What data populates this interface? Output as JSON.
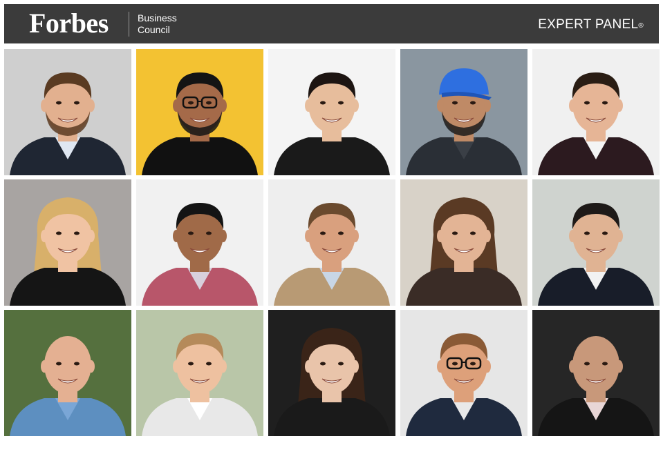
{
  "header": {
    "logo": "Forbes",
    "council_line1": "Business",
    "council_line2": "Council",
    "expert_panel": "EXPERT PANEL",
    "registered_mark": "®"
  },
  "colors": {
    "banner": "#3b3b3b",
    "text": "#ffffff"
  },
  "portraits": [
    {
      "bg": "#cfcfcf",
      "skin": "#e2b08f",
      "hair": "#5a3b22",
      "jacket": "#1f2633",
      "shirt": "#dfe7f2",
      "hairstyle": "short",
      "beard": true,
      "glasses": false,
      "cap": false
    },
    {
      "bg": "#f3c232",
      "skin": "#a56a49",
      "hair": "#141414",
      "jacket": "#111111",
      "shirt": "#111111",
      "hairstyle": "short",
      "beard": true,
      "glasses": true,
      "cap": false
    },
    {
      "bg": "#f4f4f4",
      "skin": "#e7bd9c",
      "hair": "#1d1512",
      "jacket": "#1a1a1a",
      "shirt": "#1a1a1a",
      "hairstyle": "pulled",
      "beard": false,
      "glasses": false,
      "cap": false
    },
    {
      "bg": "#8a96a0",
      "skin": "#bf8a66",
      "hair": "#1b1b1b",
      "jacket": "#2a2f36",
      "shirt": "#3a3f46",
      "hairstyle": "none",
      "beard": true,
      "glasses": false,
      "cap": true
    },
    {
      "bg": "#f0f0f0",
      "skin": "#e6b596",
      "hair": "#2a1d14",
      "jacket": "#2c1a1f",
      "shirt": "#f4f4f4",
      "hairstyle": "short",
      "beard": false,
      "glasses": false,
      "cap": false
    },
    {
      "bg": "#a8a4a2",
      "skin": "#f0c3a3",
      "hair": "#d8b06a",
      "jacket": "#151515",
      "shirt": "#151515",
      "hairstyle": "long",
      "beard": false,
      "glasses": false,
      "cap": false
    },
    {
      "bg": "#f1f1f1",
      "skin": "#a06a48",
      "hair": "#141414",
      "jacket": "#b8566a",
      "shirt": "#d8d0dc",
      "hairstyle": "short",
      "beard": false,
      "glasses": false,
      "cap": false
    },
    {
      "bg": "#eeeeee",
      "skin": "#d9a07e",
      "hair": "#6a4a2e",
      "jacket": "#b89a74",
      "shirt": "#c8d6e6",
      "hairstyle": "short",
      "beard": false,
      "glasses": false,
      "cap": false
    },
    {
      "bg": "#d8d2c8",
      "skin": "#e3b495",
      "hair": "#5a3a24",
      "jacket": "#3a2c26",
      "shirt": "#3a2c26",
      "hairstyle": "long",
      "beard": false,
      "glasses": false,
      "cap": false
    },
    {
      "bg": "#cfd3cf",
      "skin": "#e0b393",
      "hair": "#1e1a18",
      "jacket": "#181d29",
      "shirt": "#f2f2f2",
      "hairstyle": "short",
      "beard": false,
      "glasses": false,
      "cap": false
    },
    {
      "bg": "#55703e",
      "skin": "#e4b092",
      "hair": "#e4b092",
      "jacket": "#5d8fc0",
      "shirt": "#7aa6d6",
      "hairstyle": "none",
      "beard": false,
      "glasses": false,
      "cap": false
    },
    {
      "bg": "#b9c6a8",
      "skin": "#eec1a0",
      "hair": "#b58a5a",
      "jacket": "#e8e8e8",
      "shirt": "#ffffff",
      "hairstyle": "short",
      "beard": false,
      "glasses": false,
      "cap": false
    },
    {
      "bg": "#1f1f1f",
      "skin": "#e9c4aa",
      "hair": "#3a2418",
      "jacket": "#1a1a1a",
      "shirt": "#1a1a1a",
      "hairstyle": "long",
      "beard": false,
      "glasses": false,
      "cap": false
    },
    {
      "bg": "#e6e6e6",
      "skin": "#dda07a",
      "hair": "#8a5a36",
      "jacket": "#1f2a3e",
      "shirt": "#e9e9e9",
      "hairstyle": "short",
      "beard": false,
      "glasses": true,
      "cap": false
    },
    {
      "bg": "#262626",
      "skin": "#c8987a",
      "hair": "#c8987a",
      "jacket": "#151515",
      "shirt": "#e8d6d6",
      "hairstyle": "none",
      "beard": false,
      "glasses": false,
      "cap": false
    }
  ]
}
